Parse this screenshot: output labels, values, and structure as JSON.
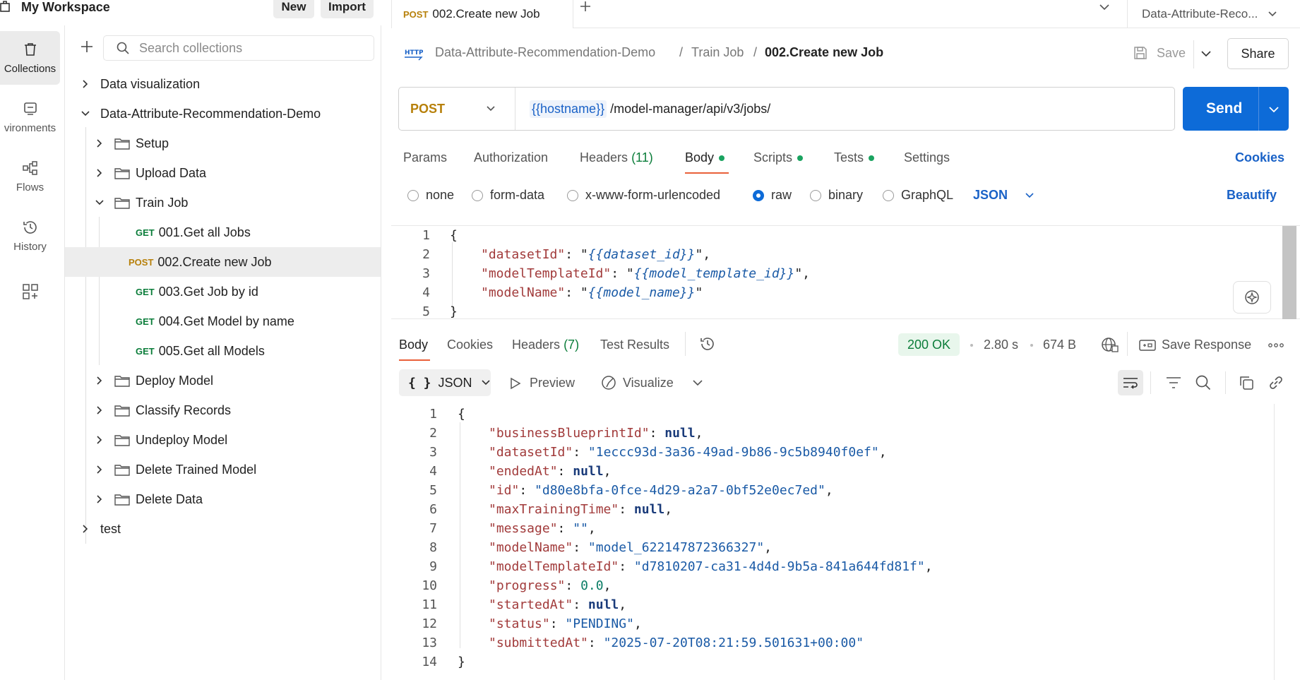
{
  "workspace": {
    "title": "My Workspace",
    "new_label": "New",
    "import_label": "Import"
  },
  "rail": [
    {
      "label": "Collections",
      "icon": "trash-icon"
    },
    {
      "label": "vironments",
      "icon": "environment-icon"
    },
    {
      "label": "Flows",
      "icon": "flows-icon"
    },
    {
      "label": "History",
      "icon": "history-icon"
    }
  ],
  "sidebar": {
    "search_placeholder": "Search collections",
    "tree": [
      {
        "label": "Data visualization"
      },
      {
        "label": "Data-Attribute-Recommendation-Demo"
      },
      {
        "label": "Setup"
      },
      {
        "label": "Upload Data"
      },
      {
        "label": "Train Job"
      },
      {
        "method": "GET",
        "label": "001.Get all Jobs"
      },
      {
        "method": "POST",
        "label": "002.Create new Job"
      },
      {
        "method": "GET",
        "label": "003.Get Job by id"
      },
      {
        "method": "GET",
        "label": "004.Get Model by name"
      },
      {
        "method": "GET",
        "label": "005.Get all Models"
      },
      {
        "label": "Deploy Model"
      },
      {
        "label": "Classify Records"
      },
      {
        "label": "Undeploy Model"
      },
      {
        "label": "Delete Trained Model"
      },
      {
        "label": "Delete Data"
      },
      {
        "label": "test"
      }
    ]
  },
  "tab": {
    "method": "POST",
    "title": "002.Create new Job"
  },
  "env_select": "Data-Attribute-Reco...",
  "breadcrumb": {
    "c1": "Data-Attribute-Recommendation-Demo",
    "sep": "/",
    "c2": "Train Job",
    "current": "002.Create new Job"
  },
  "toolbar": {
    "save_label": "Save",
    "share_label": "Share",
    "http_icon_text": "HTTP"
  },
  "request": {
    "method": "POST",
    "url_var": "{{hostname}}",
    "url_path": "/model-manager/api/v3/jobs/",
    "send_label": "Send"
  },
  "req_tabs": {
    "params": "Params",
    "auth": "Authorization",
    "headers": "Headers",
    "headers_count": "(11)",
    "body": "Body",
    "scripts": "Scripts",
    "tests": "Tests",
    "settings": "Settings",
    "cookies": "Cookies"
  },
  "body_types": {
    "none": "none",
    "form": "form-data",
    "url": "x-www-form-urlencoded",
    "raw": "raw",
    "binary": "binary",
    "graphql": "GraphQL",
    "lang": "JSON",
    "beautify": "Beautify"
  },
  "req_body": {
    "lines": [
      "1",
      "2",
      "3",
      "4",
      "5"
    ],
    "open": "{",
    "close": "}",
    "k1": "\"datasetId\"",
    "v1": "{{dataset_id}}",
    "k2": "\"modelTemplateId\"",
    "v2": "{{model_template_id}}",
    "k3": "\"modelName\"",
    "v3": "{{model_name}}"
  },
  "resp_tabs": {
    "body": "Body",
    "cookies": "Cookies",
    "headers": "Headers",
    "headers_count": "(7)",
    "tests": "Test Results"
  },
  "resp_status": {
    "code": "200 OK",
    "time": "2.80 s",
    "size": "674 B",
    "save": "Save Response"
  },
  "resp_view": {
    "format": "JSON",
    "preview": "Preview",
    "visualize": "Visualize"
  },
  "resp_body": {
    "lines": [
      "1",
      "2",
      "3",
      "4",
      "5",
      "6",
      "7",
      "8",
      "9",
      "10",
      "11",
      "12",
      "13",
      "14"
    ],
    "open": "{",
    "close": "}",
    "k_bp": "\"businessBlueprintId\"",
    "v_bp": "null",
    "k_ds": "\"datasetId\"",
    "v_ds": "\"1eccc93d-3a36-49ad-9b86-9c5b8940f0ef\"",
    "k_end": "\"endedAt\"",
    "v_end": "null",
    "k_id": "\"id\"",
    "v_id": "\"d80e8bfa-0fce-4d29-a2a7-0bf52e0ec7ed\"",
    "k_max": "\"maxTrainingTime\"",
    "v_max": "null",
    "k_msg": "\"message\"",
    "v_msg": "\"\"",
    "k_mn": "\"modelName\"",
    "v_mn": "\"model_622147872366327\"",
    "k_mt": "\"modelTemplateId\"",
    "v_mt": "\"d7810207-ca31-4d4d-9b5a-841a644fd81f\"",
    "k_pr": "\"progress\"",
    "v_pr": "0.0",
    "k_st": "\"startedAt\"",
    "v_st": "null",
    "k_stat": "\"status\"",
    "v_stat": "\"PENDING\"",
    "k_sub": "\"submittedAt\"",
    "v_sub": "\"2025-07-20T08:21:59.501631+00:00\""
  }
}
